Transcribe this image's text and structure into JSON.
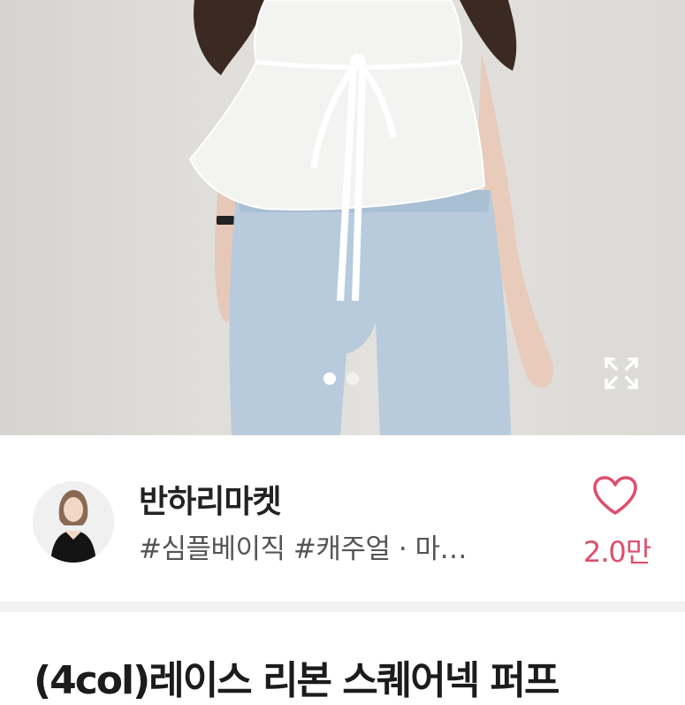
{
  "product_image": {
    "page_indicator": {
      "count": 2,
      "active_index": 0
    },
    "expand_icon": "expand-icon"
  },
  "shop": {
    "name": "반하리마켓",
    "tags": "#심플베이직 #캐주얼 · 마…",
    "like_icon": "heart-outline-icon",
    "like_count": "2.0만"
  },
  "product": {
    "title": "(4col)레이스 리본 스퀘어넥 퍼프"
  },
  "colors": {
    "accent": "#e04d6b",
    "text_primary": "#222222",
    "text_secondary": "#555555",
    "divider": "#f1f1f1"
  }
}
